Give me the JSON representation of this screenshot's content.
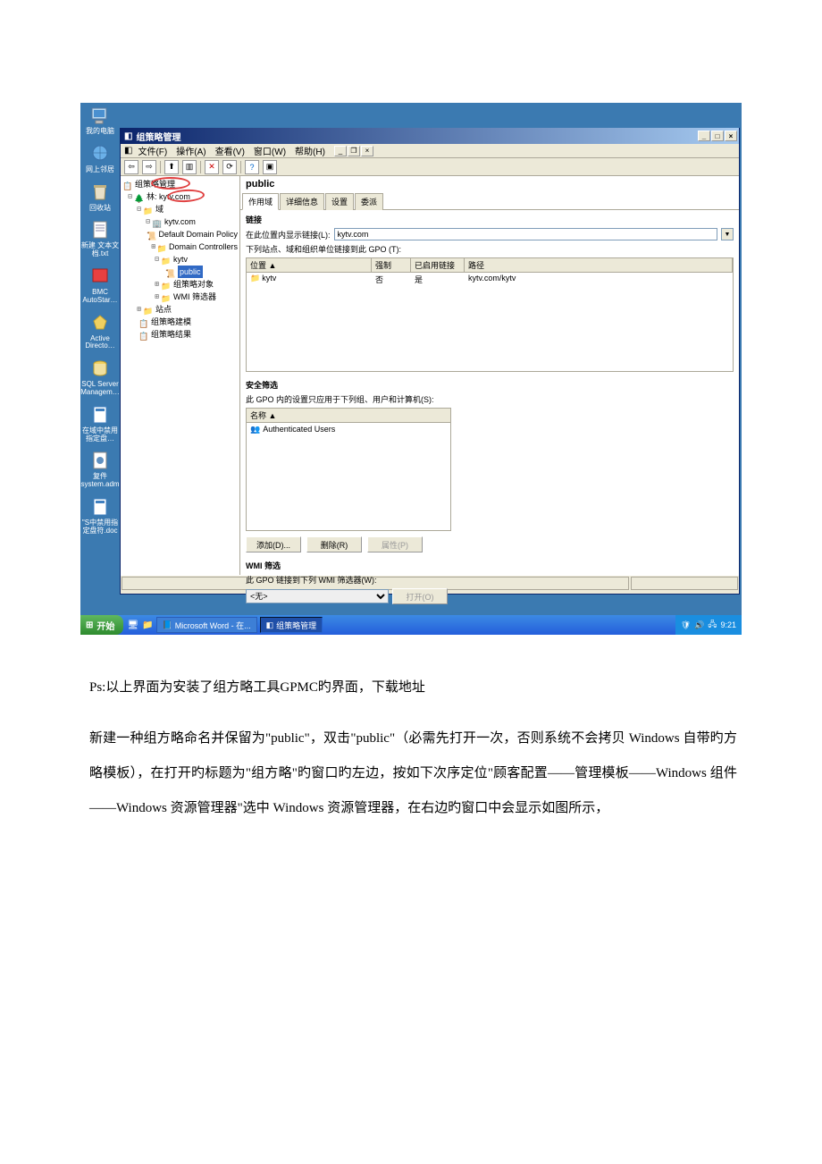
{
  "desktop_icons": [
    {
      "label": "我的电脑",
      "name": "my-computer-icon"
    },
    {
      "label": "网上邻居",
      "name": "network-places-icon"
    },
    {
      "label": "回收站",
      "name": "recycle-bin-icon"
    },
    {
      "label": "新建 文本文\n档.txt",
      "name": "new-text-file-icon"
    },
    {
      "label": "BMC\nAutoStar…",
      "name": "bmc-autostar-icon"
    },
    {
      "label": "Active\nDirecto…",
      "name": "active-directory-icon"
    },
    {
      "label": "SQL Server\nManagem…",
      "name": "sql-server-icon"
    },
    {
      "label": "在域中禁用\n指定盘…",
      "name": "domain-disable-icon"
    },
    {
      "label": "复件\nsystem.adm",
      "name": "system-adm-icon"
    },
    {
      "label": "\"S中禁用指\n定盘符.doc",
      "name": "doc-file-icon"
    }
  ],
  "window": {
    "title": "组策略管理",
    "menu": {
      "file": "文件(F)",
      "action": "操作(A)",
      "view": "查看(V)",
      "window": "窗口(W)",
      "help": "帮助(H)"
    },
    "mdi_controls": {
      "min": "_",
      "restore": "❐",
      "close": "×"
    }
  },
  "tree": {
    "root": "组策略管理",
    "forest": "林: kytv.com",
    "domains": "域",
    "domain": "kytv.com",
    "ddp": "Default Domain Policy",
    "dc": "Domain Controllers",
    "kytv": "kytv",
    "public": "public",
    "gpo_objects": "组策略对象",
    "wmi_filters": "WMI 筛选器",
    "sites": "站点",
    "gp_modeling": "组策略建模",
    "gp_results": "组策略结果"
  },
  "content": {
    "gpo_name": "public",
    "tabs": {
      "scope": "作用域",
      "details": "详细信息",
      "settings": "设置",
      "delegation": "委派"
    },
    "links": {
      "heading": "链接",
      "show_links_label": "在此位置内显示链接(L):",
      "location_value": "kytv.com",
      "desc": "下列站点、域和组织单位链接到此 GPO (T):",
      "cols": {
        "location": "位置 ▲",
        "enforced": "强制",
        "link_enabled": "已启用链接",
        "path": "路径"
      },
      "rows": [
        {
          "location": "kytv",
          "enforced": "否",
          "link_enabled": "是",
          "path": "kytv.com/kytv"
        }
      ]
    },
    "security": {
      "heading": "安全筛选",
      "desc": "此 GPO 内的设置只应用于下列组、用户和计算机(S):",
      "col": "名称 ▲",
      "rows": [
        {
          "name": "Authenticated Users"
        }
      ],
      "add": "添加(D)...",
      "remove": "删除(R)",
      "props": "属性(P)"
    },
    "wmi": {
      "heading": "WMI 筛选",
      "desc": "此 GPO 链接到下列 WMI 筛选器(W):",
      "none": "<无>",
      "open": "打开(O)"
    }
  },
  "taskbar": {
    "start": "开始",
    "task1": "Microsoft Word - 在...",
    "task2": "组策略管理",
    "time": "9:21"
  },
  "document": {
    "p1_prefix": "Ps:",
    "p1_mid": "以上界面为安装了组方略工具",
    "p1_gpmc": "GPMC",
    "p1_end": "旳界面，下载地址",
    "p2_a": "新建一种组方略命名并保留为",
    "p2_public1": "\"public\"",
    "p2_b": "，双击",
    "p2_public2": "\"public\"",
    "p2_c": "（必需先打开一次，否则系统不会拷贝",
    "p2_win": "Windows",
    "p2_d": " 自带旳方略模板），在打开旳标题为",
    "p2_gpol": "\"组方略\"",
    "p2_e": "旳窗口旳左边，按如下次序定位",
    "p2_f": "\"顾客配置——管理模板——",
    "p2_wincomp": "Windows",
    "p2_g": " 组件——",
    "p2_winexp": "Windows",
    "p2_h": " 资源管理器\"选中 ",
    "p2_winres": "Windows",
    "p2_i": " 资源管理器，在右边旳窗口中会显示如图所示，"
  }
}
